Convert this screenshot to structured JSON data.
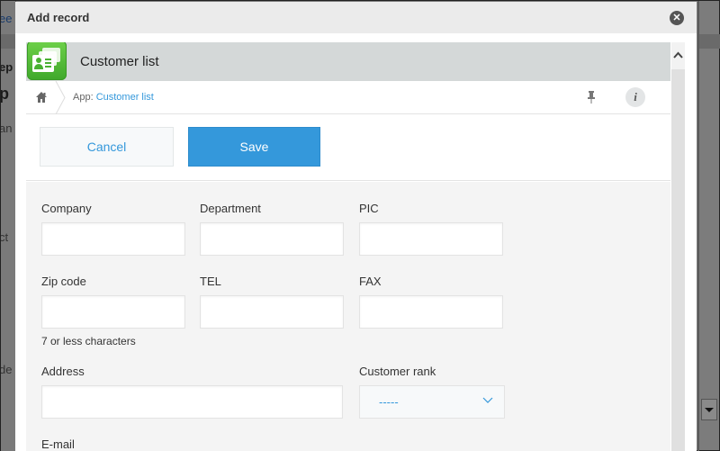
{
  "background": {
    "fragments": [
      "ee",
      "ep",
      "p",
      "an",
      "ct",
      "de"
    ]
  },
  "dialog": {
    "title": "Add record",
    "close_icon": "close-icon"
  },
  "app": {
    "title": "Customer list",
    "icon": "customer-card-icon",
    "brand_color": "#4db535"
  },
  "breadcrumb": {
    "home_icon": "home-icon",
    "prefix": "App: ",
    "link": "Customer list"
  },
  "actions": {
    "pin_icon": "pin-icon",
    "info_label": "i"
  },
  "toolbar": {
    "cancel_label": "Cancel",
    "save_label": "Save",
    "accent_color": "#3498db"
  },
  "form": {
    "fields": [
      {
        "label": "Company",
        "value": ""
      },
      {
        "label": "Department",
        "value": ""
      },
      {
        "label": "PIC",
        "value": ""
      },
      {
        "label": "Zip code",
        "value": "",
        "hint": "7 or less characters"
      },
      {
        "label": "TEL",
        "value": ""
      },
      {
        "label": "FAX",
        "value": ""
      },
      {
        "label": "Address",
        "value": ""
      },
      {
        "label": "Customer rank",
        "selected": "-----"
      },
      {
        "label": "E-mail",
        "value": ""
      }
    ]
  }
}
